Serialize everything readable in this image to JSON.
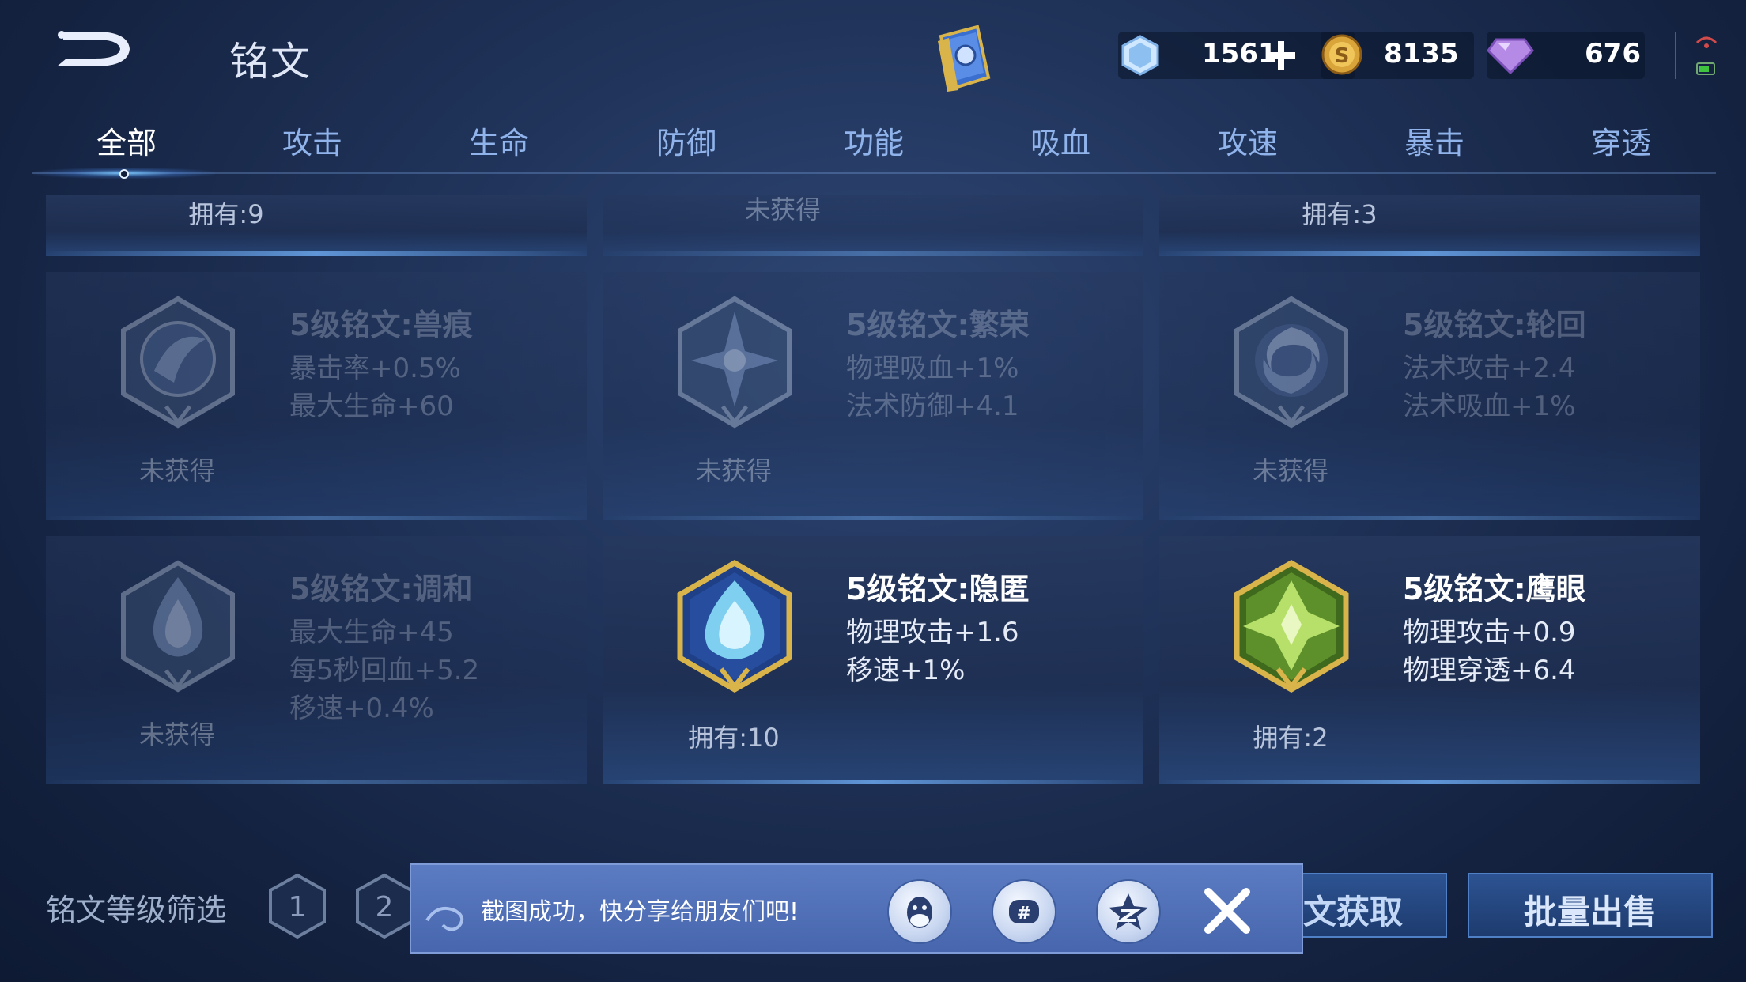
{
  "header": {
    "title": "铭文",
    "currencies": [
      {
        "icon": "crystal-icon",
        "value": "1561"
      },
      {
        "icon": "gold-coin-icon",
        "value": "8135"
      },
      {
        "icon": "diamond-icon",
        "value": "676"
      }
    ]
  },
  "tabs": [
    {
      "label": "全部",
      "active": true
    },
    {
      "label": "攻击"
    },
    {
      "label": "生命"
    },
    {
      "label": "防御"
    },
    {
      "label": "功能"
    },
    {
      "label": "吸血"
    },
    {
      "label": "攻速"
    },
    {
      "label": "暴击"
    },
    {
      "label": "穿透"
    }
  ],
  "top_row": [
    {
      "owned": "拥有:9"
    },
    {
      "owned": "未获得"
    },
    {
      "owned": "拥有:3"
    }
  ],
  "runes": [
    {
      "name": "5级铭文:兽痕",
      "stats": [
        "暴击率+0.5%",
        "最大生命+60"
      ],
      "owned": "未获得",
      "acquired": false,
      "emblem": "beast-mark-emblem-icon"
    },
    {
      "name": "5级铭文:繁荣",
      "stats": [
        "物理吸血+1%",
        "法术防御+4.1"
      ],
      "owned": "未获得",
      "acquired": false,
      "emblem": "prosperity-emblem-icon"
    },
    {
      "name": "5级铭文:轮回",
      "stats": [
        "法术攻击+2.4",
        "法术吸血+1%"
      ],
      "owned": "未获得",
      "acquired": false,
      "emblem": "samsara-emblem-icon"
    },
    {
      "name": "5级铭文:调和",
      "stats": [
        "最大生命+45",
        "每5秒回血+5.2",
        "移速+0.4%"
      ],
      "owned": "未获得",
      "acquired": false,
      "emblem": "harmony-emblem-icon"
    },
    {
      "name": "5级铭文:隐匿",
      "stats": [
        "物理攻击+1.6",
        "移速+1%"
      ],
      "owned": "拥有:10",
      "acquired": true,
      "emblem": "stealth-emblem-icon"
    },
    {
      "name": "5级铭文:鹰眼",
      "stats": [
        "物理攻击+0.9",
        "物理穿透+6.4"
      ],
      "owned": "拥有:2",
      "acquired": true,
      "emblem": "hawkeye-emblem-icon"
    }
  ],
  "footer": {
    "filter_label": "铭文等级筛选",
    "levels": [
      "1",
      "2"
    ],
    "get_button": "文获取",
    "sell_button": "批量出售"
  },
  "toast": {
    "message": "截图成功，快分享给朋友们吧!",
    "share_targets": [
      "qq-icon",
      "wechat-moments-icon",
      "qzone-icon"
    ]
  },
  "colors": {
    "accent": "#8fb3ea",
    "toast_bg": "#4f6fb5",
    "gold": "#d9b44a"
  }
}
